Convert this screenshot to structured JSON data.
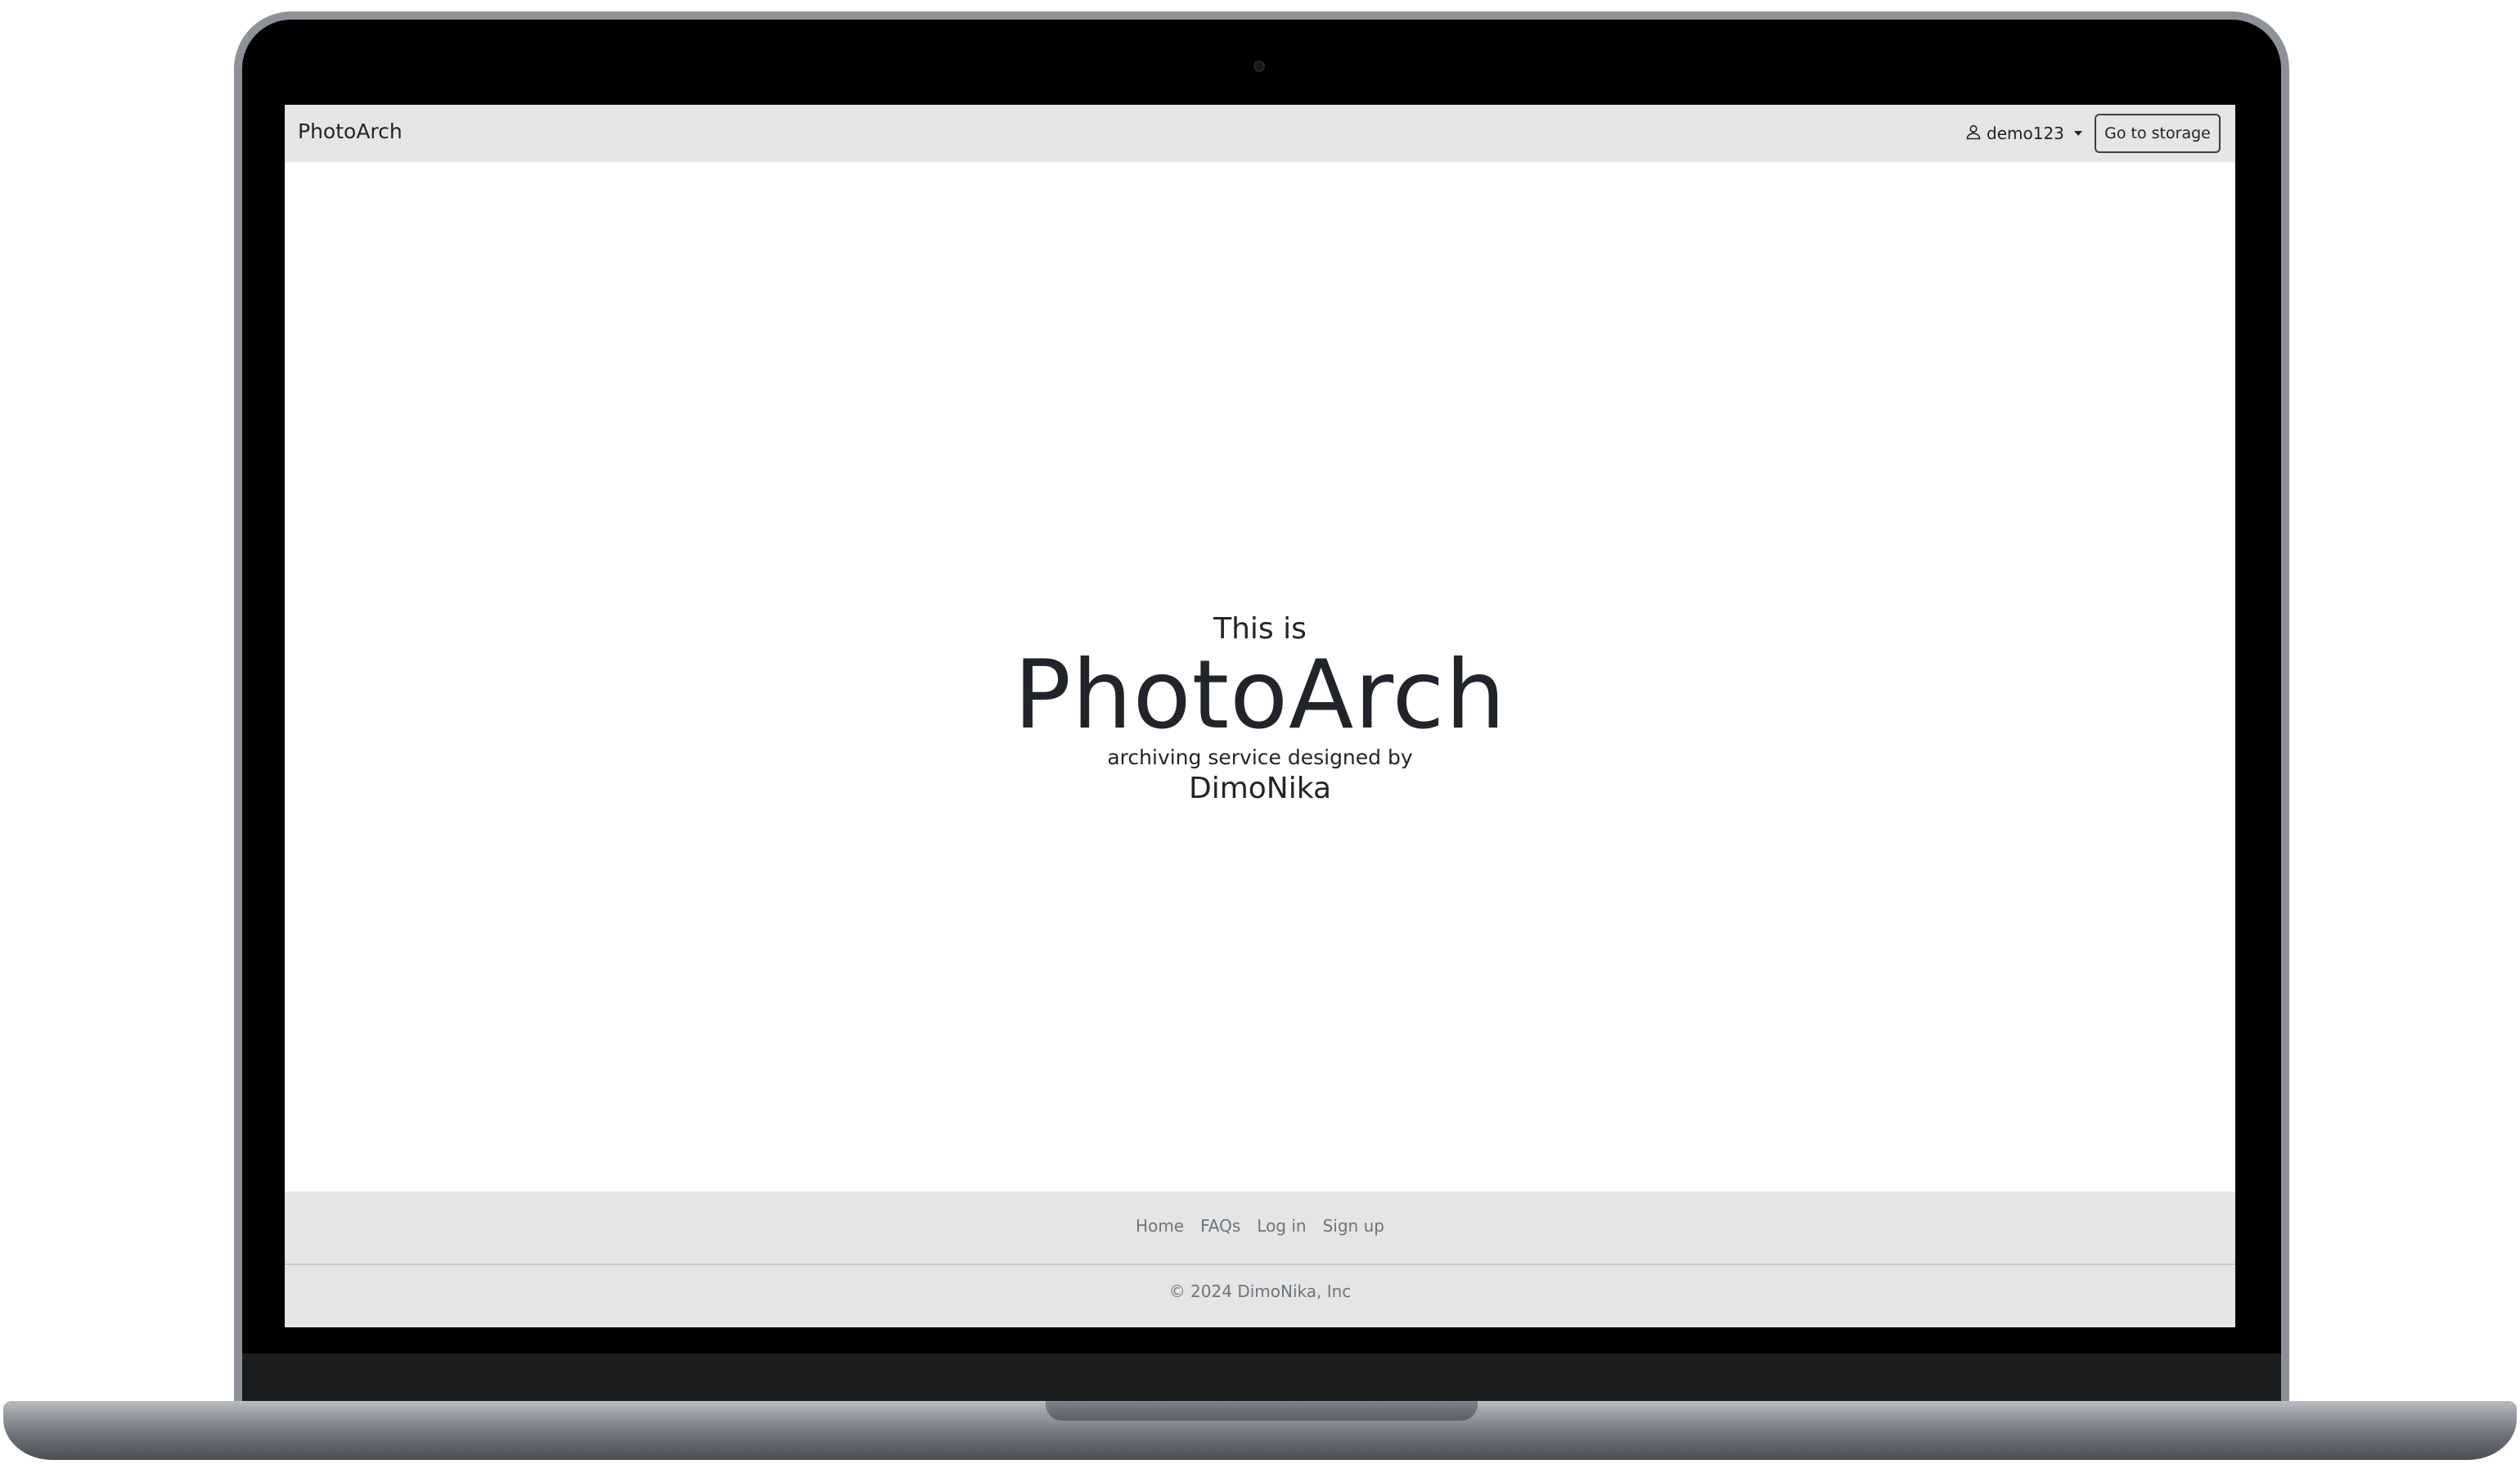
{
  "navbar": {
    "brand": "PhotoArch",
    "user": {
      "name": "demo123",
      "icon": "person-icon"
    },
    "storage_button": "Go to storage"
  },
  "hero": {
    "intro": "This is",
    "title": "PhotoArch",
    "tagline": "archiving service designed by",
    "author": "DimoNika"
  },
  "footer": {
    "links": [
      "Home",
      "FAQs",
      "Log in",
      "Sign up"
    ],
    "copyright": "© 2024 DimoNika, Inc"
  }
}
